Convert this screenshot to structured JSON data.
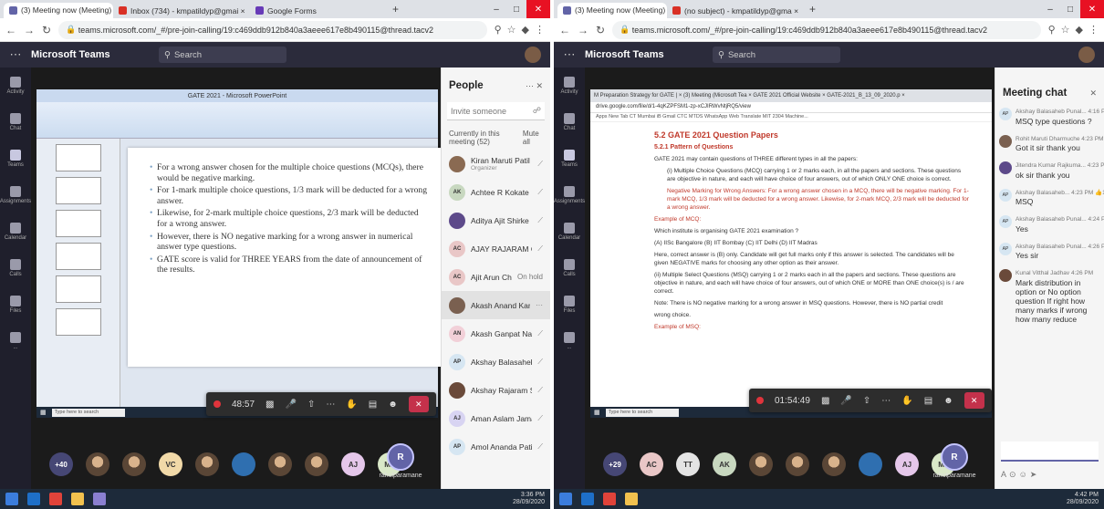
{
  "left": {
    "tabs": [
      {
        "label": "(3) Meeting now (Meeting) | ⊙ ×",
        "color": "#6264a7",
        "active": true
      },
      {
        "label": "Inbox (734) - kmpatildyp@gmai ×",
        "color": "#d93025"
      },
      {
        "label": "Google Forms",
        "color": "#673ab7"
      }
    ],
    "url": "teams.microsoft.com/_#/pre-join-calling/19:c469ddb912b840a3aeee617e8b490115@thread.tacv2",
    "brand": "Microsoft Teams",
    "search": "Search",
    "rail": [
      "Activity",
      "Chat",
      "Teams",
      "Assignments",
      "Calendar",
      "Calls",
      "Files",
      "..."
    ],
    "ppt_title": "GATE 2021 - Microsoft PowerPoint",
    "slide_bullets": [
      "For a wrong answer chosen for the multiple choice questions (MCQs), there would be negative marking.",
      "For 1-mark multiple choice questions, 1/3 mark will be deducted for a wrong answer.",
      "Likewise, for 2-mark multiple choice questions, 2/3 mark will be deducted for a wrong answer.",
      "However, there is NO negative marking for a wrong answer in numerical answer type questions.",
      "GATE score is valid for THREE YEARS from the date of announcement of the results."
    ],
    "inner_search": "Type here to search",
    "timer": "48:57",
    "hangup": "✕",
    "people_title": "People",
    "invite": "Invite someone",
    "meeting_label": "Currently in this meeting (52)",
    "mute_all": "Mute all",
    "participants": [
      {
        "name": "Kiran Maruti Patil",
        "sub": "Organizer",
        "init": "",
        "color": "#8a6a52",
        "status": "⟋"
      },
      {
        "name": "Achtee R Kokate",
        "sub": "",
        "init": "AK",
        "color": "#c8d8c0",
        "status": "⟋"
      },
      {
        "name": "Aditya Ajit Shirke",
        "sub": "",
        "init": "",
        "color": "#5d4a8a",
        "status": "⟋"
      },
      {
        "name": "AJAY RAJARAM CHAVAN",
        "sub": "",
        "init": "AC",
        "color": "#e9c7c7",
        "status": "⟋"
      },
      {
        "name": "Ajit Arun Chougule",
        "sub": "",
        "init": "AC",
        "color": "#e9c7c7",
        "status": "On hold"
      },
      {
        "name": "Akash Anand Kamble",
        "sub": "",
        "init": "",
        "color": "#7a6050",
        "status": "···"
      },
      {
        "name": "Akash Ganpat Nalawade",
        "sub": "",
        "init": "AN",
        "color": "#f2d0d8",
        "status": "⟋"
      },
      {
        "name": "Akshay Balasaheb Punalkar",
        "sub": "",
        "init": "AP",
        "color": "#d6e6f2",
        "status": "⟋"
      },
      {
        "name": "Akshay Rajaram Salunke",
        "sub": "",
        "init": "",
        "color": "#6a4a3a",
        "status": "⟋"
      },
      {
        "name": "Aman Aslam Jamadar",
        "sub": "",
        "init": "AJ",
        "color": "#d8d4f2",
        "status": "⟋"
      },
      {
        "name": "Amol Ananda Patil",
        "sub": "",
        "init": "AP",
        "color": "#d6e6f2",
        "status": "⟋"
      }
    ],
    "avatars": [
      {
        "t": "+40",
        "c": "#464775",
        "dark": true
      },
      {
        "t": "",
        "c": "photo"
      },
      {
        "t": "",
        "c": "photo"
      },
      {
        "t": "VC",
        "c": "#f1d9a8"
      },
      {
        "t": "",
        "c": "photo"
      },
      {
        "t": "",
        "c": "#2f6fb0"
      },
      {
        "t": "",
        "c": "photo"
      },
      {
        "t": "",
        "c": "photo"
      },
      {
        "t": "AJ",
        "c": "#e5c7ea"
      },
      {
        "t": "ML",
        "c": "#d9e8c8"
      }
    ],
    "me_initial": "R",
    "me_name": "rahulparamane",
    "clock_time": "3:36 PM",
    "clock_date": "28/09/2020"
  },
  "right": {
    "tabs": [
      {
        "label": "(3) Meeting now (Meeting) | ⊙ ×",
        "color": "#6264a7",
        "active": true
      },
      {
        "label": "(no subject) - kmpatildyp@gma ×",
        "color": "#d93025"
      }
    ],
    "url": "teams.microsoft.com/_#/pre-join-calling/19:c469ddb912b840a3aeee617e8b490115@thread.tacv2",
    "brand": "Microsoft Teams",
    "search": "Search",
    "inner_tabs": "M Preparation Strategy for GATE | ×   (3) Meeting (Microsoft Tea ×   GATE 2021 Official Website ×   GATE-2021_B_13_09_2020.p ×",
    "inner_url": "drive.google.com/file/d/1-4qKZPFSM1-zp-xCJIRWvNtjRQ5/view",
    "bookmarks": "Apps  New Tab  CT Mumbai  iB  Gmail  CTC MTDS  WhatsApp Web  Translate  MIT 2304 Machine...",
    "doc_h2": "5.2 GATE 2021 Question Papers",
    "doc_h3": "5.2.1 Pattern of Questions",
    "doc_intro": "GATE 2021 may contain questions of THREE different types in all the papers:",
    "doc_mcq": "(i) Multiple Choice Questions (MCQ) carrying 1 or 2 marks each, in all the papers and sections. These questions are objective in nature, and each will have choice of four answers, out of which ONLY ONE choice is correct.",
    "doc_neg": "Negative Marking for Wrong Answers: For a wrong answer chosen in a MCQ, there will be negative marking. For 1-mark MCQ, 1/3 mark will be deducted for a wrong answer. Likewise, for 2-mark MCQ, 2/3 mark will be deducted for a wrong answer.",
    "doc_ex": "Example of MCQ:",
    "doc_q": "Which institute is organising GATE 2021 examination ?",
    "doc_opts": "(A) IISc Bangalore  (B) IIT Bombay  (C) IIT Delhi  (D) IIT Madras",
    "doc_ans": "Here, correct answer is (B) only. Candidate will get full marks only if this answer is selected. The candidates will be given NEGATIVE marks for choosing any other option as their answer.",
    "doc_msq": "(ii) Multiple Select Questions (MSQ) carrying 1 or 2 marks each in all the papers and sections. These questions are objective in nature, and each will have choice of four answers, out of which ONE or MORE than ONE choice(s) is / are correct.",
    "doc_note": "Note: There is NO negative marking for a wrong answer in MSQ questions. However, there is NO partial credit",
    "doc_note2": "wrong choice.",
    "doc_ex2": "Example of MSQ:",
    "timer": "01:54:49",
    "hangup": "✕",
    "inner_search": "Type here to search",
    "inner_user": "rahulparamane",
    "chat_title": "Meeting chat",
    "messages": [
      {
        "init": "AP",
        "color": "#d6e6f2",
        "head": "Akshay Balasaheb Punal... 4:16 PM",
        "text": "MSQ type questions ?"
      },
      {
        "init": "",
        "color": "#7a6050",
        "head": "Rohit Maruti Dharmuche 4:23 PM",
        "text": "Got it sir thank you"
      },
      {
        "init": "",
        "color": "#5d4a8a",
        "head": "Jitendra Kumar Rajkuma... 4:23 PM",
        "text": "ok sir thank you"
      },
      {
        "init": "AP",
        "color": "#d6e6f2",
        "head": "Akshay Balasaheb... 4:23 PM 👍1",
        "text": "MSQ"
      },
      {
        "init": "AP",
        "color": "#d6e6f2",
        "head": "Akshay Balasaheb Punal... 4:24 PM",
        "text": "Yes"
      },
      {
        "init": "AP",
        "color": "#d6e6f2",
        "head": "Akshay Balasaheb Punal... 4:26 PM",
        "text": "Yes sir"
      },
      {
        "init": "",
        "color": "#6a4a3a",
        "head": "Kunal Vitthal Jadhav 4:26 PM",
        "text": "Mark distribution in option or No option question If right how many marks if wrong how many reduce"
      }
    ],
    "avatars": [
      {
        "t": "+29",
        "c": "#464775",
        "dark": true
      },
      {
        "t": "AC",
        "c": "#e9c7c7"
      },
      {
        "t": "TT",
        "c": "#e4e4e4"
      },
      {
        "t": "AK",
        "c": "#c8d8c0"
      },
      {
        "t": "",
        "c": "photo"
      },
      {
        "t": "",
        "c": "photo"
      },
      {
        "t": "",
        "c": "photo"
      },
      {
        "t": "",
        "c": "#2f6fb0"
      },
      {
        "t": "AJ",
        "c": "#e5c7ea"
      },
      {
        "t": "ML",
        "c": "#d9e8c8"
      }
    ],
    "me_initial": "R",
    "me_name": "rahulparamane",
    "clock_time": "4:42 PM",
    "clock_date": "28/09/2020"
  }
}
